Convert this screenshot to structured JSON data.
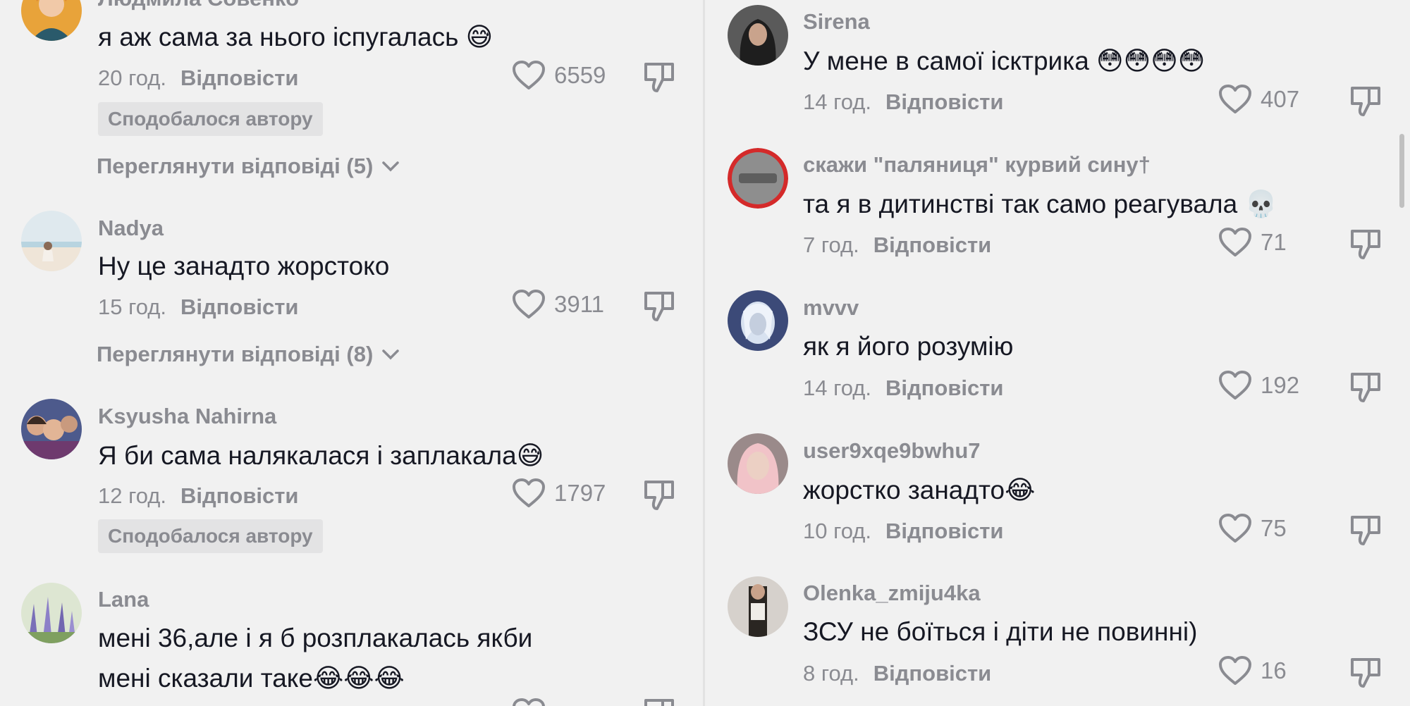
{
  "left": {
    "comments": [
      {
        "username": "Людмила Совенко",
        "text": "я аж сама за нього іспугалась 😅",
        "time": "20 год.",
        "reply": "Відповісти",
        "likes": "6559",
        "liked_by_author": "Сподобалося автору",
        "view_replies": "Переглянути відповіді (5)"
      },
      {
        "username": "Nadya",
        "text": "Ну це занадто жорстоко",
        "time": "15 год.",
        "reply": "Відповісти",
        "likes": "3911",
        "view_replies": "Переглянути відповіді (8)"
      },
      {
        "username": "Ksyusha Nahirna",
        "text": "Я би сама налякалася і заплакала😅",
        "time": "12 год.",
        "reply": "Відповісти",
        "likes": "1797",
        "liked_by_author": "Сподобалося автору"
      },
      {
        "username": "Lana",
        "text_line1": "мені 36,але і я б розплакалась якби",
        "text_line2": "мені сказали таке😂😂😂"
      }
    ]
  },
  "right": {
    "comments": [
      {
        "username": "Sirena",
        "text": "У мене в самої ісктрика 😳😳😳😳",
        "time": "14 год.",
        "reply": "Відповісти",
        "likes": "407"
      },
      {
        "username": "скажи \"паляниця\" курвий сину†",
        "text": "та я в дитинстві так само реагувала 💀",
        "time": "7 год.",
        "reply": "Відповісти",
        "likes": "71"
      },
      {
        "username": "mvvv",
        "text": "як я його розумію",
        "time": "14 год.",
        "reply": "Відповісти",
        "likes": "192"
      },
      {
        "username": "user9xqe9bwhu7",
        "text": "жорстко занадто😂",
        "time": "10 год.",
        "reply": "Відповісти",
        "likes": "75"
      },
      {
        "username": "Olenka_zmiju4ka",
        "text": "ЗСУ не боїться і діти не повинні)",
        "time": "8 год.",
        "reply": "Відповісти",
        "likes": "16"
      }
    ]
  },
  "icons": {
    "like": "heart-outline-icon",
    "dislike": "thumbs-down-icon",
    "expand": "chevron-down-icon"
  }
}
